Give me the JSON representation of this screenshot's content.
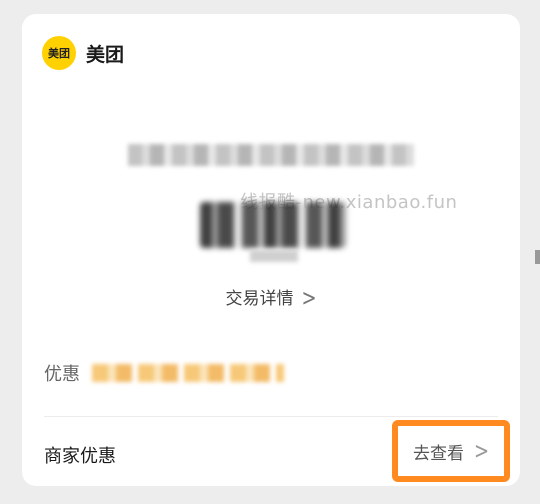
{
  "merchant": {
    "logo_text": "美团",
    "name": "美团"
  },
  "watermark": "线报酷-new.xianbao.fun",
  "transaction_detail": {
    "label": "交易详情",
    "chevron": ">"
  },
  "discount": {
    "label": "优惠"
  },
  "merchant_discount": {
    "label": "商家优惠",
    "action_label": "去查看",
    "chevron": ">"
  },
  "colors": {
    "logo_yellow": "#ffd100",
    "highlight_orange": "#ff8a1f",
    "background": "#ededed",
    "card": "#ffffff"
  },
  "icons": {
    "merchant_logo": "meituan-logo-icon",
    "chevron": "chevron-right-icon"
  }
}
